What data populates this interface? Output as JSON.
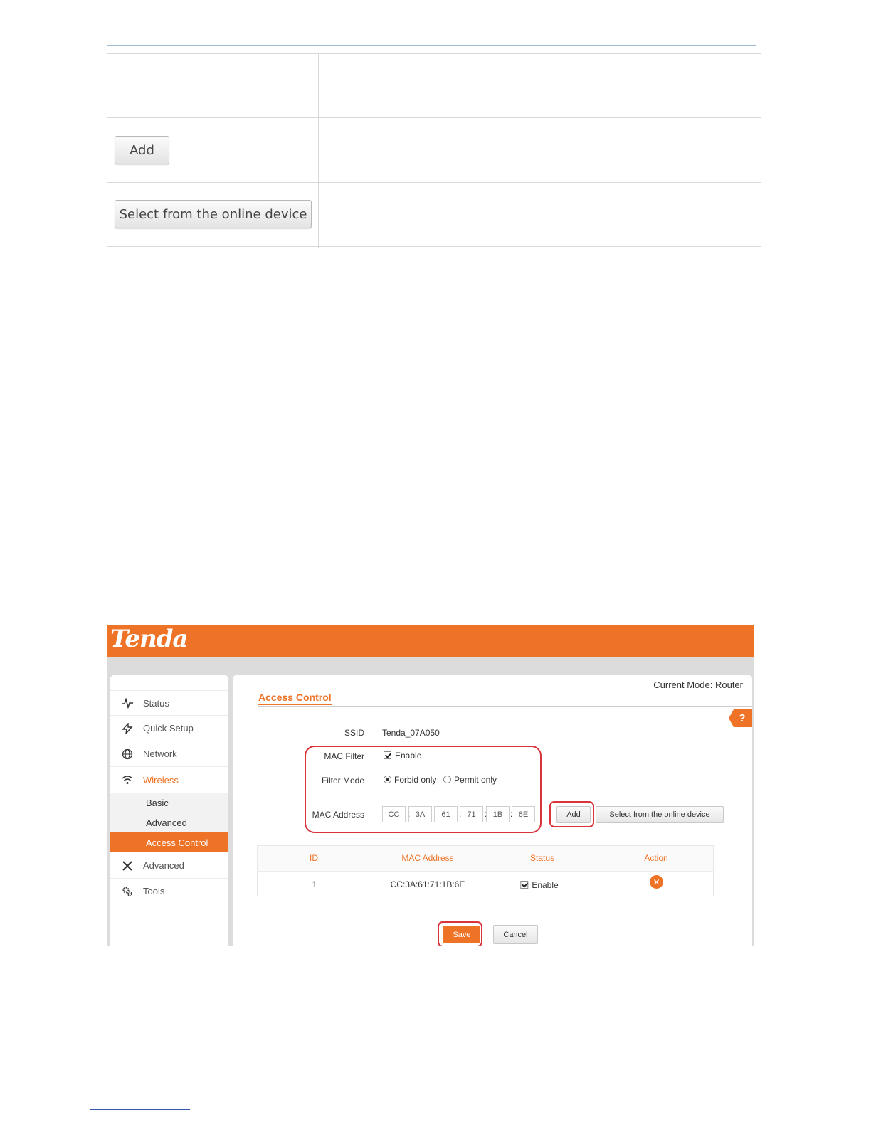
{
  "doc_buttons": {
    "add": "Add",
    "select": "Select from the online device"
  },
  "app": {
    "brand": "Tenda",
    "current_mode": "Current Mode: Router",
    "help": "?",
    "colors": {
      "accent": "#ee7326",
      "highlight": "#d9343b"
    }
  },
  "sidebar": {
    "items": [
      {
        "label": "Status",
        "icon": "pulse-icon"
      },
      {
        "label": "Quick Setup",
        "icon": "lightning-icon"
      },
      {
        "label": "Network",
        "icon": "globe-icon"
      },
      {
        "label": "Wireless",
        "icon": "wifi-icon"
      },
      {
        "label": "Advanced",
        "icon": "tools-icon"
      },
      {
        "label": "Tools",
        "icon": "gears-icon"
      }
    ],
    "wireless_sub": [
      "Basic",
      "Advanced",
      "Access Control"
    ]
  },
  "page": {
    "title": "Access Control",
    "ssid_label": "SSID",
    "ssid_value": "Tenda_07A050",
    "mac_filter_label": "MAC Filter",
    "mac_filter_option": "Enable",
    "filter_mode_label": "Filter Mode",
    "filter_mode_options": [
      "Forbid only",
      "Permit only"
    ],
    "filter_mode_selected": "Forbid only",
    "mac_address_label": "MAC Address",
    "mac_octets": [
      "CC",
      "3A",
      "61",
      "71",
      "1B",
      "6E"
    ],
    "mac_separator": ":",
    "add_button": "Add",
    "select_button": "Select from the online device"
  },
  "table": {
    "headers": [
      "ID",
      "MAC Address",
      "Status",
      "Action"
    ],
    "rows": [
      {
        "id": "1",
        "mac": "CC:3A:61:71:1B:6E",
        "status": "Enable",
        "action": "delete-icon"
      }
    ]
  },
  "footer_buttons": {
    "save": "Save",
    "cancel": "Cancel"
  }
}
